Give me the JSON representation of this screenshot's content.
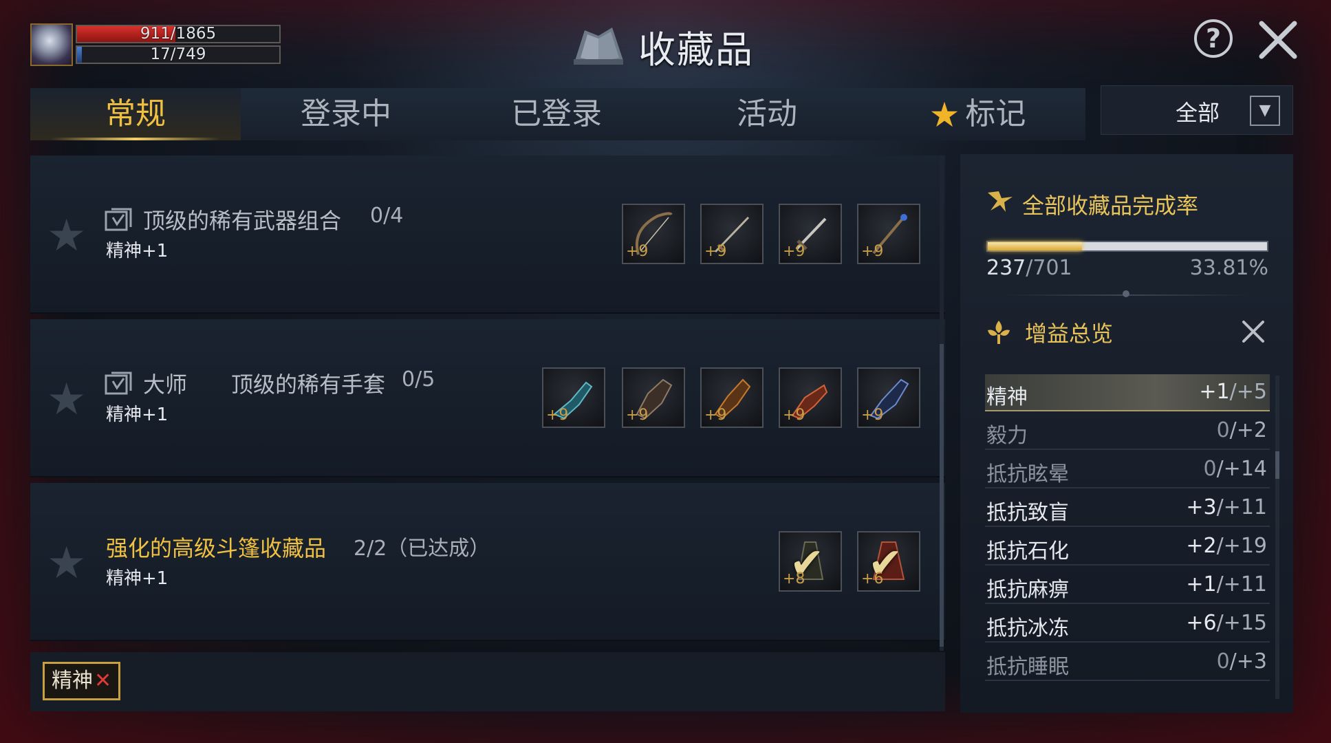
{
  "player": {
    "hp": "911/1865",
    "hp_pct": 48.8,
    "mp": "17/749",
    "mp_pct": 2.3
  },
  "title": "收藏品",
  "tabs": [
    {
      "label": "常规",
      "active": true
    },
    {
      "label": "登录中",
      "active": false
    },
    {
      "label": "已登录",
      "active": false
    },
    {
      "label": "活动",
      "active": false
    },
    {
      "label": "标记",
      "active": false,
      "icon": "star-icon"
    }
  ],
  "filter": {
    "label": "全部"
  },
  "collections": [
    {
      "name": "顶级的稀有武器组合",
      "count": "0/4",
      "bonus": "精神+1",
      "completed": false,
      "items": [
        "+9",
        "+9",
        "+9",
        "+9"
      ]
    },
    {
      "name": "大师　　顶级的稀有手套",
      "count": "0/5",
      "bonus": "精神+1",
      "completed": false,
      "items": [
        "+9",
        "+9",
        "+9",
        "+9",
        "+9"
      ]
    },
    {
      "name": "强化的高级斗篷收藏品",
      "count": "2/2（已达成）",
      "bonus": "精神+1",
      "completed": true,
      "items": [
        "+8",
        "+6"
      ]
    }
  ],
  "filter_tag": {
    "label": "精神",
    "remove": "✕"
  },
  "completion": {
    "heading": "全部收藏品完成率",
    "count": "237",
    "total": "/701",
    "percent": "33.81%",
    "fraction": 0.3381
  },
  "buffs": {
    "heading": "增益总览",
    "stats": [
      {
        "name": "精神",
        "value": "+1",
        "max": "/+5",
        "state": "highlight"
      },
      {
        "name": "毅力",
        "value": "0",
        "max": "/+2",
        "state": "dim"
      },
      {
        "name": "抵抗眩晕",
        "value": "0",
        "max": "/+14",
        "state": "dim"
      },
      {
        "name": "抵抗致盲",
        "value": "+3",
        "max": "/+11",
        "state": "normal"
      },
      {
        "name": "抵抗石化",
        "value": "+2",
        "max": "/+19",
        "state": "normal"
      },
      {
        "name": "抵抗麻痹",
        "value": "+1",
        "max": "/+11",
        "state": "normal"
      },
      {
        "name": "抵抗冰冻",
        "value": "+6",
        "max": "/+15",
        "state": "normal"
      },
      {
        "name": "抵抗睡眠",
        "value": "0",
        "max": "/+3",
        "state": "dim"
      }
    ]
  }
}
